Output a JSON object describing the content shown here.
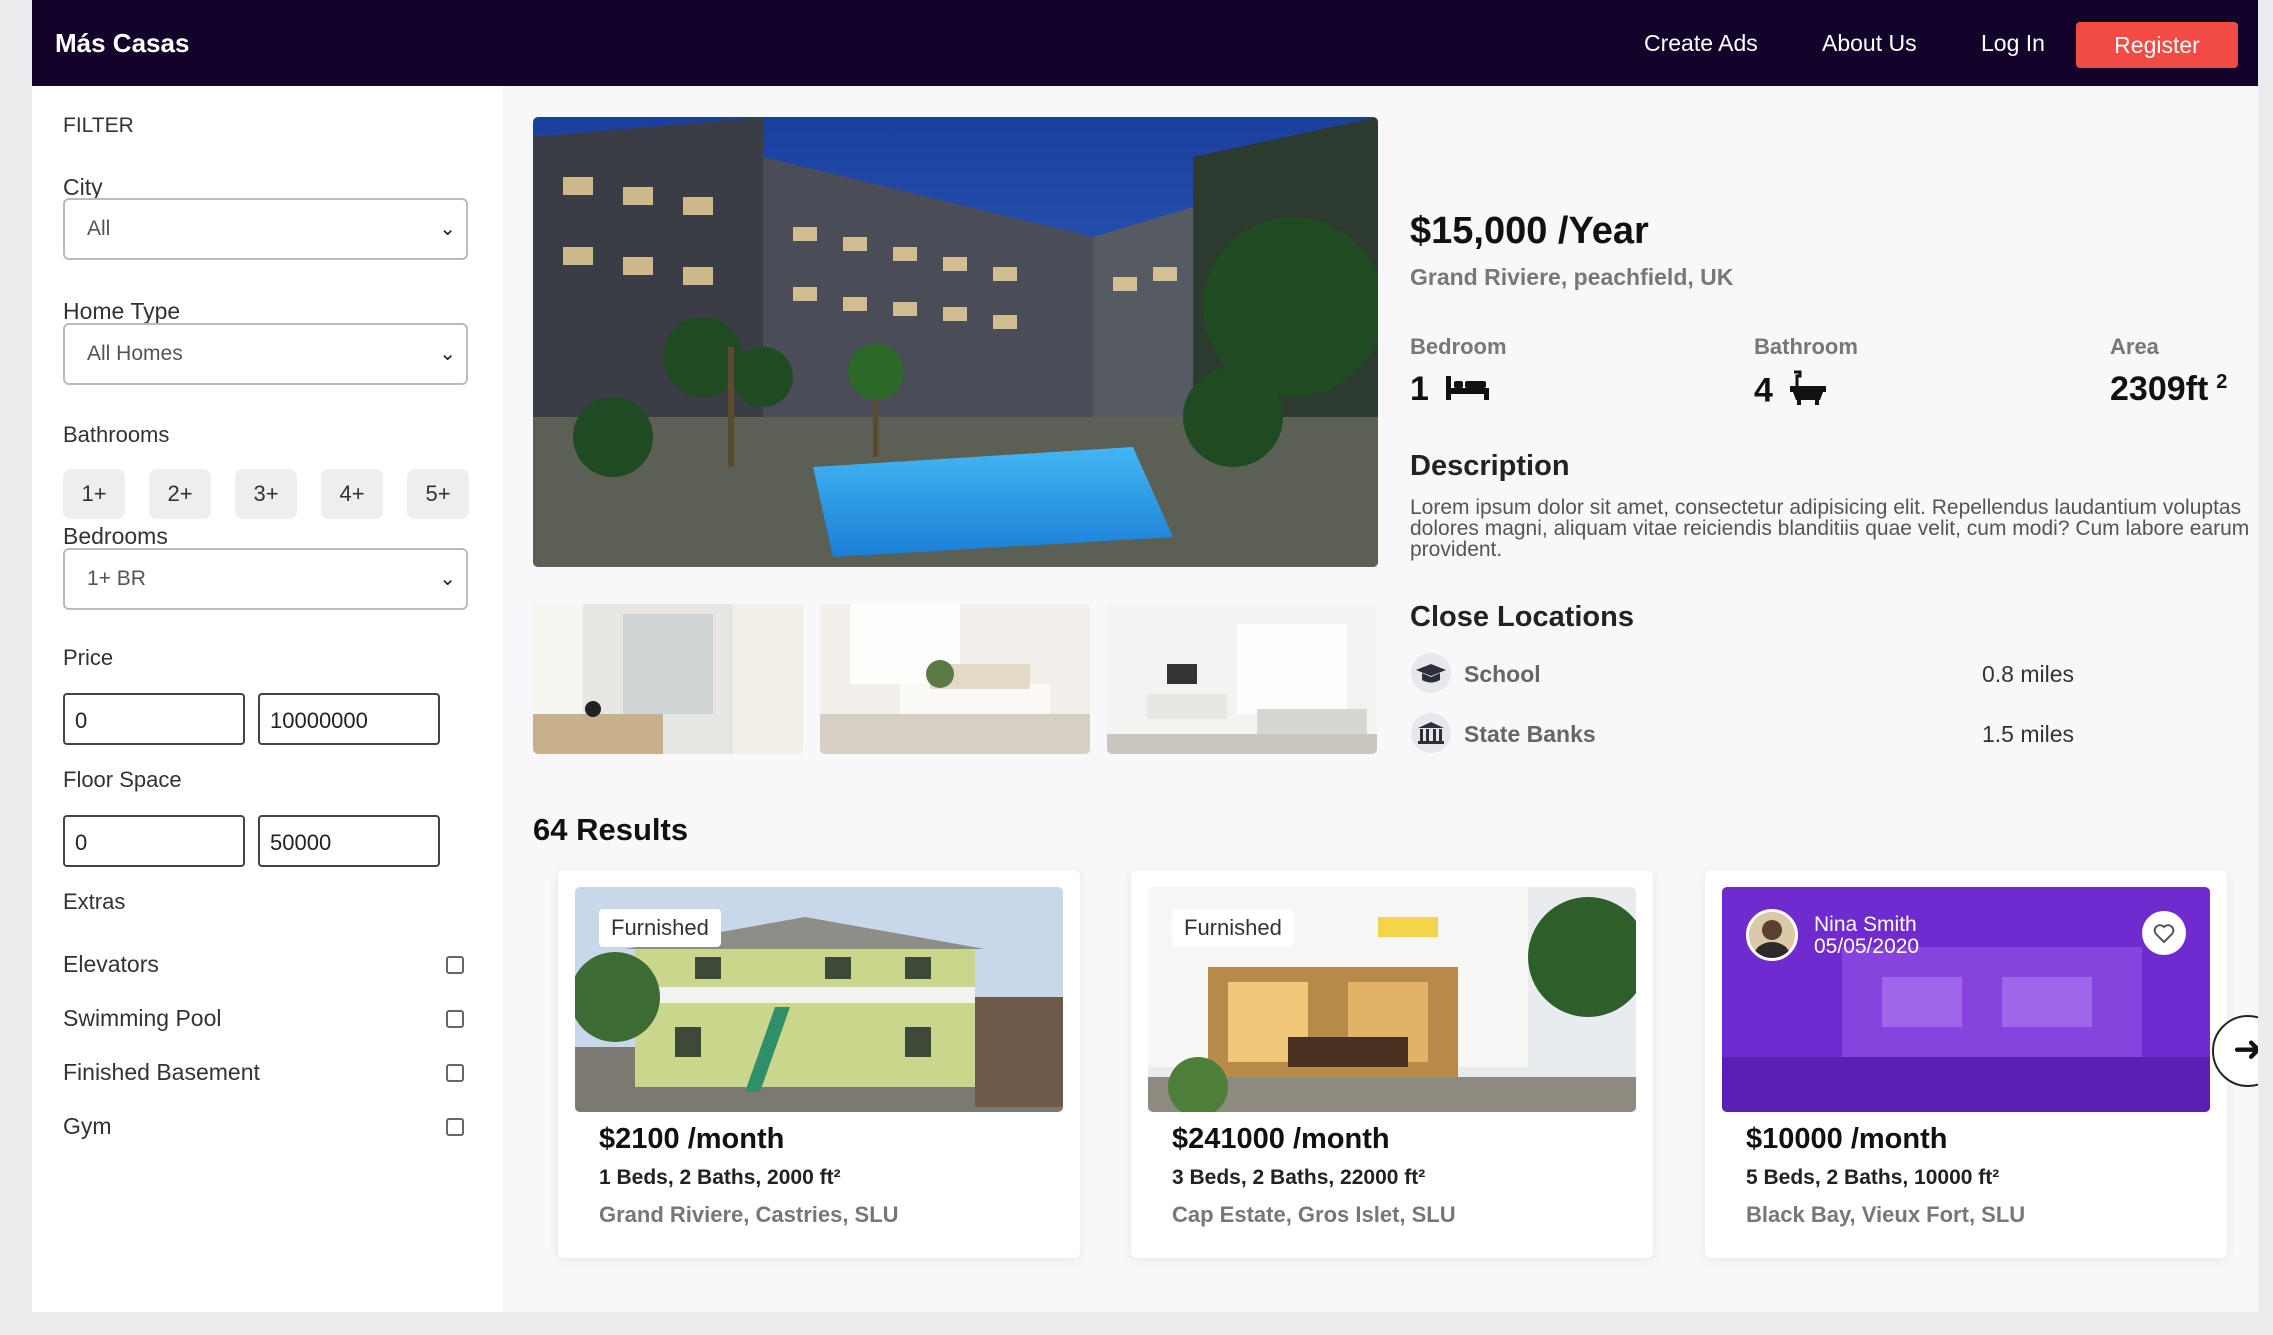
{
  "nav": {
    "brand": "Más Casas",
    "links": [
      "Create Ads",
      "About Us",
      "Log In"
    ],
    "register": "Register"
  },
  "filter": {
    "title": "FILTER",
    "city_label": "City",
    "city_value": "All",
    "home_type_label": "Home Type",
    "home_type_value": "All Homes",
    "bathrooms_label": "Bathrooms",
    "bathroom_options": [
      "1+",
      "2+",
      "3+",
      "4+",
      "5+"
    ],
    "bedrooms_label": "Bedrooms",
    "bedrooms_value": "1+ BR",
    "price_label": "Price",
    "price_min": "0",
    "price_max": "10000000",
    "floor_label": "Floor Space",
    "floor_min": "0",
    "floor_max": "50000",
    "extras_label": "Extras",
    "extras": [
      "Elevators",
      "Swimming Pool",
      "Finished Basement",
      "Gym"
    ]
  },
  "listing": {
    "price": "$15,000 /Year",
    "address": "Grand Riviere, peachfield, UK",
    "bedroom_label": "Bedroom",
    "bedroom_value": "1",
    "bathroom_label": "Bathroom",
    "bathroom_value": "4",
    "area_label": "Area",
    "area_value": "2309ft",
    "area_unit": "2",
    "description_title": "Description",
    "description": "Lorem ipsum dolor sit amet, consectetur adipisicing elit. Repellendus laudantium voluptas dolores magni, aliquam vitae reiciendis blanditiis quae velit, cum modi? Cum labore earum provident.",
    "close_title": "Close Locations",
    "locations": [
      {
        "name": "School",
        "distance": "0.8 miles",
        "icon": "graduation-cap-icon"
      },
      {
        "name": "State Banks",
        "distance": "1.5 miles",
        "icon": "bank-icon"
      }
    ]
  },
  "results": {
    "count_label": "64 Results",
    "cards": [
      {
        "tag": "Furnished",
        "price": "$2100 /month",
        "specs": "1 Beds, 2 Baths, 2000 ft²",
        "address": "Grand Riviere, Castries, SLU"
      },
      {
        "tag": "Furnished",
        "price": "$241000 /month",
        "specs": "3 Beds, 2 Baths, 22000 ft²",
        "address": "Cap Estate, Gros Islet, SLU"
      },
      {
        "agent_name": "Nina Smith",
        "agent_date": "05/05/2020",
        "price": "$10000 /month",
        "specs": "5 Beds, 2 Baths, 10000 ft²",
        "address": "Black Bay, Vieux Fort, SLU"
      }
    ]
  },
  "colors": {
    "nav_bg": "#11032a",
    "register_bg": "#f14b44",
    "card_overlay": "#7a2bd9"
  }
}
